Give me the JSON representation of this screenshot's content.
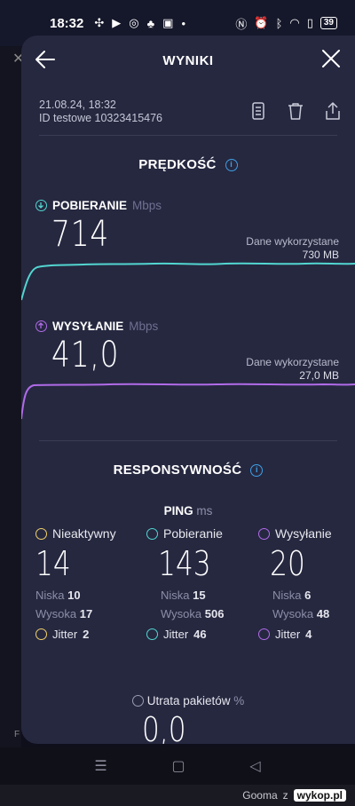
{
  "status_bar": {
    "time": "18:32",
    "battery": "39"
  },
  "header": {
    "title": "WYNIKI"
  },
  "meta": {
    "date": "21.08.24, 18:32",
    "test_id": "ID testowe 10323415476"
  },
  "speed": {
    "title": "PRĘDKOŚĆ",
    "download": {
      "label": "POBIERANIE",
      "unit": "Mbps",
      "value": "714",
      "usage_label": "Dane wykorzystane",
      "usage_value": "730 MB",
      "color": "#52d6d0"
    },
    "upload": {
      "label": "WYSYŁANIE",
      "unit": "Mbps",
      "value": "41,0",
      "usage_label": "Dane wykorzystane",
      "usage_value": "27,0 MB",
      "color": "#b16be8"
    }
  },
  "responsiveness": {
    "title": "RESPONSYWNOŚĆ",
    "ping_label": "PING",
    "ping_unit": "ms",
    "columns": [
      {
        "label": "Nieaktywny",
        "value": "14",
        "low_label": "Niska",
        "low": "10",
        "high_label": "Wysoka",
        "high": "17",
        "jitter_label": "Jitter",
        "jitter": "2",
        "color": "#f0d06a"
      },
      {
        "label": "Pobieranie",
        "value": "143",
        "low_label": "Niska",
        "low": "15",
        "high_label": "Wysoka",
        "high": "506",
        "jitter_label": "Jitter",
        "jitter": "46",
        "color": "#52d6d0"
      },
      {
        "label": "Wysyłanie",
        "value": "20",
        "low_label": "Niska",
        "low": "6",
        "high_label": "Wysoka",
        "high": "48",
        "jitter_label": "Jitter",
        "jitter": "4",
        "color": "#b16be8"
      }
    ],
    "packet_loss_label": "Utrata pakietów",
    "packet_loss_unit": "%",
    "packet_loss_value": "0,0"
  },
  "footer": {
    "user": "Gooma",
    "z": "z",
    "site": "wykop.pl"
  }
}
